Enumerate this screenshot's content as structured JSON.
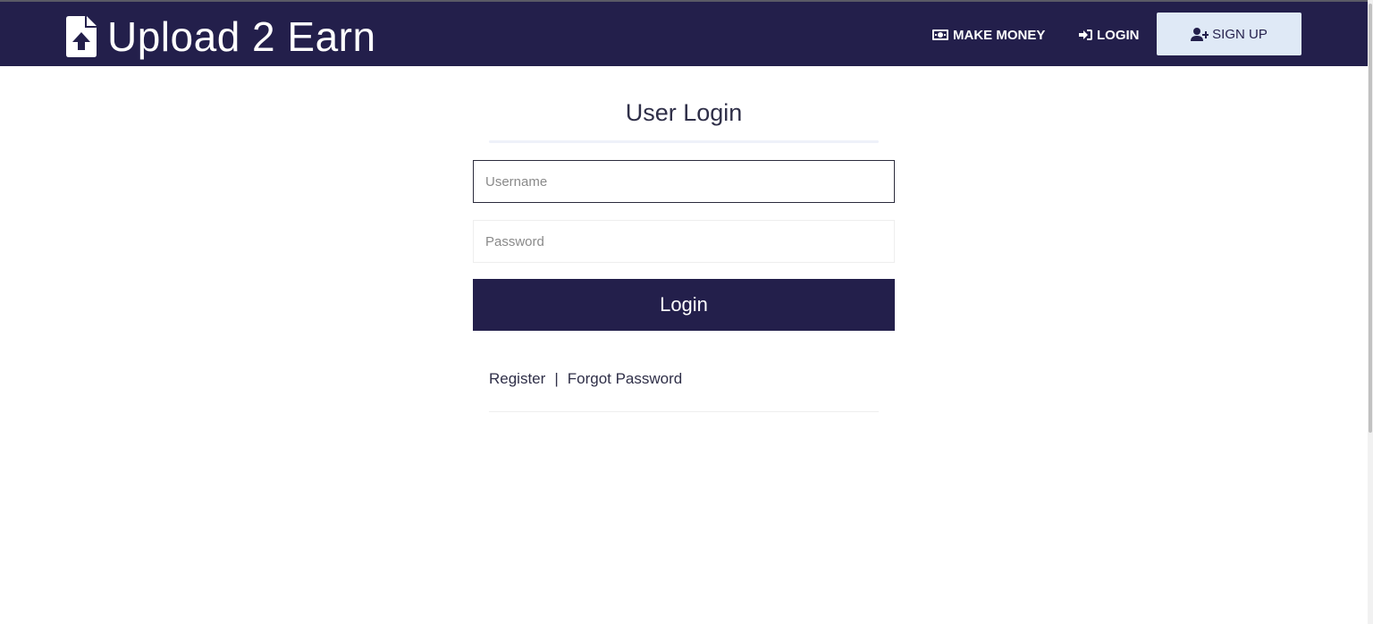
{
  "brand": {
    "title": "Upload 2 Earn",
    "icon": "file-upload-icon"
  },
  "nav": {
    "make_money": {
      "label": "MAKE MONEY",
      "icon": "money-bill-icon"
    },
    "login": {
      "label": "LOGIN",
      "icon": "sign-in-icon"
    },
    "signup": {
      "label": "SIGN UP",
      "icon": "user-plus-icon"
    }
  },
  "login_form": {
    "title": "User Login",
    "username_placeholder": "Username",
    "password_placeholder": "Password",
    "submit_label": "Login",
    "register_link": "Register",
    "separator": "|",
    "forgot_link": "Forgot Password"
  },
  "colors": {
    "navbar": "#231f4b",
    "signup_bg": "#dfe9f6",
    "button": "#231f4b",
    "text": "#2f2f48"
  }
}
